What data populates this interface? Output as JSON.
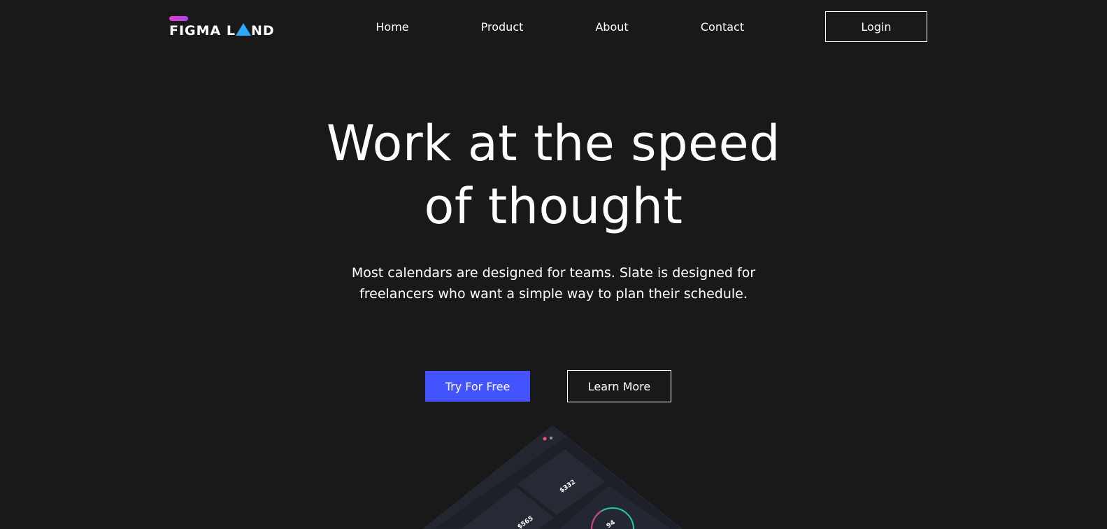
{
  "brand": {
    "name_part1": "FIGMA L",
    "name_part2": "ND",
    "bar_color": "#e23ad6",
    "triangle_color": "#2aa9ff"
  },
  "nav": {
    "links": [
      {
        "label": "Home"
      },
      {
        "label": "Product"
      },
      {
        "label": "About"
      },
      {
        "label": "Contact"
      }
    ],
    "login_label": "Login"
  },
  "hero": {
    "title_line1": "Work at the speed",
    "title_line2": "of thought",
    "subtitle_line1": "Most calendars are designed for teams. Slate is designed for",
    "subtitle_line2": "freelancers who want a simple way to plan their schedule.",
    "primary_cta": "Try For Free",
    "secondary_cta": "Learn More",
    "primary_color": "#4353ff"
  },
  "dashboard_preview": {
    "stat_1": "$332",
    "stat_2": "$565",
    "stat_3": "94",
    "ring_color": "#23c8b0"
  },
  "colors": {
    "background": "#191919",
    "text": "#ffffff"
  }
}
